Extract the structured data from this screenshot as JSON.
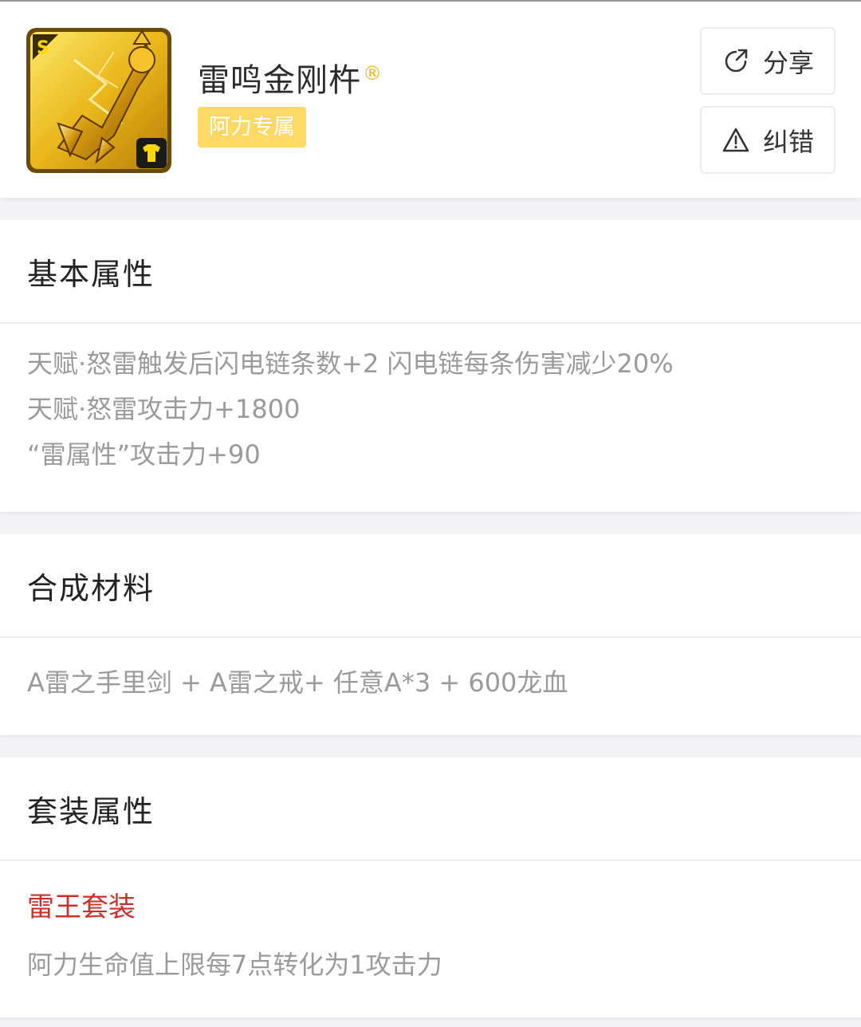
{
  "item": {
    "name": "雷鸣金刚杵",
    "registered_mark": "®",
    "tag": "阿力专属",
    "icon": "golden-vajra-weapon-icon",
    "grade_badge": "S"
  },
  "actions": {
    "share_label": "分享",
    "report_label": "纠错"
  },
  "sections": {
    "basic": {
      "title": "基本属性",
      "lines": [
        "天赋·怒雷触发后闪电链条数+2 闪电链每条伤害减少20%",
        "天赋·怒雷攻击力+1800",
        "“雷属性”攻击力+90"
      ]
    },
    "materials": {
      "title": "合成材料",
      "text": "A雷之手里剑 + A雷之戒+ 任意A*3 + 600龙血"
    },
    "set": {
      "title": "套装属性",
      "set_name": "雷王套装",
      "effect": "阿力生命值上限每7点转化为1攻击力"
    }
  },
  "colors": {
    "tag_bg": "#ffd866",
    "set_name": "#c9302c",
    "muted_text": "#9a9a9a"
  }
}
